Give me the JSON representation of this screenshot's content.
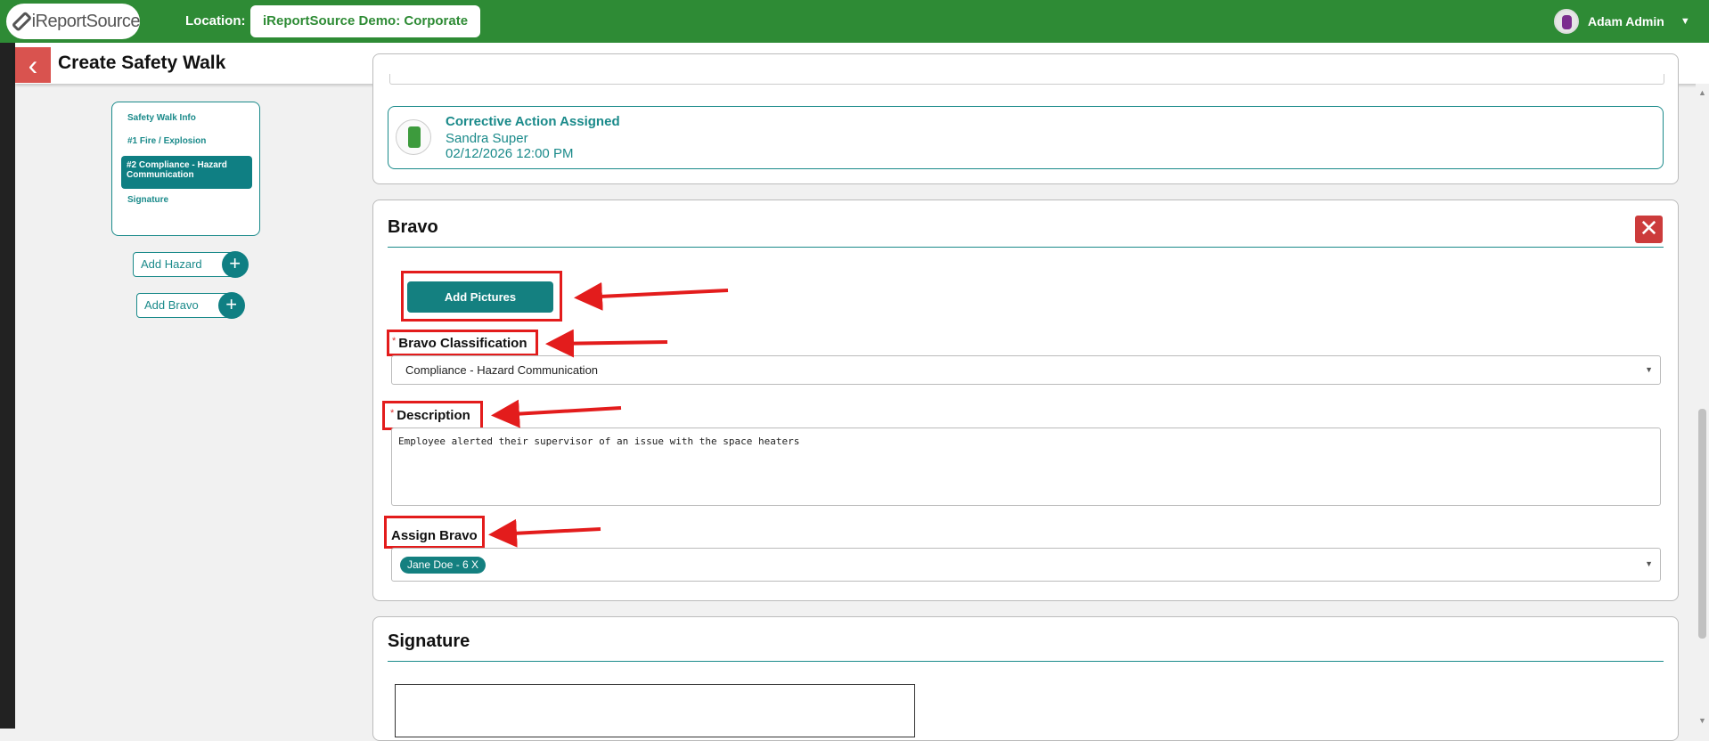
{
  "header": {
    "logo_text": "iReportSource",
    "location_label": "Location:",
    "location_value": "iReportSource Demo: Corporate",
    "user_name": "Adam Admin"
  },
  "page": {
    "title": "Create Safety Walk"
  },
  "nav": {
    "items": [
      "Safety Walk Info",
      "#1 Fire / Explosion",
      "#2 Compliance - Hazard Communication",
      "Signature"
    ],
    "active_index": 2,
    "add_hazard_label": "Add Hazard",
    "add_bravo_label": "Add Bravo"
  },
  "corrective_action": {
    "title": "Corrective Action Assigned",
    "assignee": "Sandra Super",
    "datetime": "02/12/2026 12:00 PM"
  },
  "bravo": {
    "title": "Bravo",
    "add_pictures_label": "Add Pictures",
    "classification_label": "Bravo Classification",
    "classification_value": "Compliance - Hazard Communication",
    "description_label": "Description",
    "description_value": "Employee alerted their supervisor of an issue with the space heaters",
    "assign_label": "Assign Bravo",
    "assigned_tag": "Jane Doe - 6  X",
    "required_marker": "*"
  },
  "signature": {
    "title": "Signature"
  },
  "colors": {
    "header_green": "#2e8b35",
    "teal": "#148080",
    "annotation_red": "#e31c1c",
    "delete_red": "#cc3b3b"
  },
  "icons": [
    "back-chevron-icon",
    "plus-icon",
    "close-icon",
    "dropdown-caret-icon",
    "user-avatar-icon",
    "corrective-action-icon"
  ]
}
